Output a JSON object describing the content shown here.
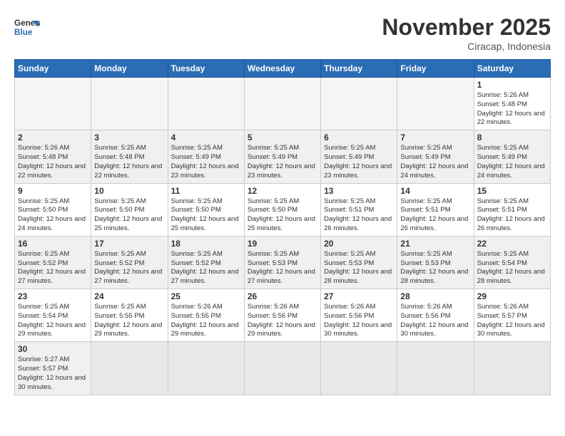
{
  "header": {
    "logo_general": "General",
    "logo_blue": "Blue",
    "month_title": "November 2025",
    "subtitle": "Ciracap, Indonesia"
  },
  "weekdays": [
    "Sunday",
    "Monday",
    "Tuesday",
    "Wednesday",
    "Thursday",
    "Friday",
    "Saturday"
  ],
  "weeks": [
    [
      {
        "day": "",
        "info": ""
      },
      {
        "day": "",
        "info": ""
      },
      {
        "day": "",
        "info": ""
      },
      {
        "day": "",
        "info": ""
      },
      {
        "day": "",
        "info": ""
      },
      {
        "day": "",
        "info": ""
      },
      {
        "day": "1",
        "info": "Sunrise: 5:26 AM\nSunset: 5:48 PM\nDaylight: 12 hours\nand 22 minutes."
      }
    ],
    [
      {
        "day": "2",
        "info": "Sunrise: 5:26 AM\nSunset: 5:48 PM\nDaylight: 12 hours\nand 22 minutes."
      },
      {
        "day": "3",
        "info": "Sunrise: 5:25 AM\nSunset: 5:48 PM\nDaylight: 12 hours\nand 22 minutes."
      },
      {
        "day": "4",
        "info": "Sunrise: 5:25 AM\nSunset: 5:49 PM\nDaylight: 12 hours\nand 23 minutes."
      },
      {
        "day": "5",
        "info": "Sunrise: 5:25 AM\nSunset: 5:49 PM\nDaylight: 12 hours\nand 23 minutes."
      },
      {
        "day": "6",
        "info": "Sunrise: 5:25 AM\nSunset: 5:49 PM\nDaylight: 12 hours\nand 23 minutes."
      },
      {
        "day": "7",
        "info": "Sunrise: 5:25 AM\nSunset: 5:49 PM\nDaylight: 12 hours\nand 24 minutes."
      },
      {
        "day": "8",
        "info": "Sunrise: 5:25 AM\nSunset: 5:49 PM\nDaylight: 12 hours\nand 24 minutes."
      }
    ],
    [
      {
        "day": "9",
        "info": "Sunrise: 5:25 AM\nSunset: 5:50 PM\nDaylight: 12 hours\nand 24 minutes."
      },
      {
        "day": "10",
        "info": "Sunrise: 5:25 AM\nSunset: 5:50 PM\nDaylight: 12 hours\nand 25 minutes."
      },
      {
        "day": "11",
        "info": "Sunrise: 5:25 AM\nSunset: 5:50 PM\nDaylight: 12 hours\nand 25 minutes."
      },
      {
        "day": "12",
        "info": "Sunrise: 5:25 AM\nSunset: 5:50 PM\nDaylight: 12 hours\nand 25 minutes."
      },
      {
        "day": "13",
        "info": "Sunrise: 5:25 AM\nSunset: 5:51 PM\nDaylight: 12 hours\nand 26 minutes."
      },
      {
        "day": "14",
        "info": "Sunrise: 5:25 AM\nSunset: 5:51 PM\nDaylight: 12 hours\nand 26 minutes."
      },
      {
        "day": "15",
        "info": "Sunrise: 5:25 AM\nSunset: 5:51 PM\nDaylight: 12 hours\nand 26 minutes."
      }
    ],
    [
      {
        "day": "16",
        "info": "Sunrise: 5:25 AM\nSunset: 5:52 PM\nDaylight: 12 hours\nand 27 minutes."
      },
      {
        "day": "17",
        "info": "Sunrise: 5:25 AM\nSunset: 5:52 PM\nDaylight: 12 hours\nand 27 minutes."
      },
      {
        "day": "18",
        "info": "Sunrise: 5:25 AM\nSunset: 5:52 PM\nDaylight: 12 hours\nand 27 minutes."
      },
      {
        "day": "19",
        "info": "Sunrise: 5:25 AM\nSunset: 5:53 PM\nDaylight: 12 hours\nand 27 minutes."
      },
      {
        "day": "20",
        "info": "Sunrise: 5:25 AM\nSunset: 5:53 PM\nDaylight: 12 hours\nand 28 minutes."
      },
      {
        "day": "21",
        "info": "Sunrise: 5:25 AM\nSunset: 5:53 PM\nDaylight: 12 hours\nand 28 minutes."
      },
      {
        "day": "22",
        "info": "Sunrise: 5:25 AM\nSunset: 5:54 PM\nDaylight: 12 hours\nand 28 minutes."
      }
    ],
    [
      {
        "day": "23",
        "info": "Sunrise: 5:25 AM\nSunset: 5:54 PM\nDaylight: 12 hours\nand 29 minutes."
      },
      {
        "day": "24",
        "info": "Sunrise: 5:25 AM\nSunset: 5:55 PM\nDaylight: 12 hours\nand 29 minutes."
      },
      {
        "day": "25",
        "info": "Sunrise: 5:26 AM\nSunset: 5:55 PM\nDaylight: 12 hours\nand 29 minutes."
      },
      {
        "day": "26",
        "info": "Sunrise: 5:26 AM\nSunset: 5:56 PM\nDaylight: 12 hours\nand 29 minutes."
      },
      {
        "day": "27",
        "info": "Sunrise: 5:26 AM\nSunset: 5:56 PM\nDaylight: 12 hours\nand 30 minutes."
      },
      {
        "day": "28",
        "info": "Sunrise: 5:26 AM\nSunset: 5:56 PM\nDaylight: 12 hours\nand 30 minutes."
      },
      {
        "day": "29",
        "info": "Sunrise: 5:26 AM\nSunset: 5:57 PM\nDaylight: 12 hours\nand 30 minutes."
      }
    ],
    [
      {
        "day": "30",
        "info": "Sunrise: 5:27 AM\nSunset: 5:57 PM\nDaylight: 12 hours\nand 30 minutes."
      },
      {
        "day": "",
        "info": ""
      },
      {
        "day": "",
        "info": ""
      },
      {
        "day": "",
        "info": ""
      },
      {
        "day": "",
        "info": ""
      },
      {
        "day": "",
        "info": ""
      },
      {
        "day": "",
        "info": ""
      }
    ]
  ]
}
